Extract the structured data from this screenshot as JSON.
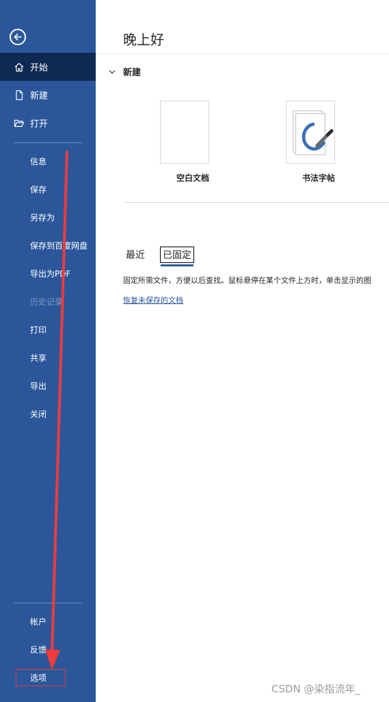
{
  "sidebar": {
    "top_items": [
      {
        "label": "开始",
        "icon": "home-icon"
      },
      {
        "label": "新建",
        "icon": "new-document-icon"
      },
      {
        "label": "打开",
        "icon": "open-folder-icon"
      }
    ],
    "sub_items": [
      {
        "label": "信息"
      },
      {
        "label": "保存"
      },
      {
        "label": "另存为"
      },
      {
        "label": "保存到百度网盘"
      },
      {
        "label": "导出为PDF"
      },
      {
        "label": "历史记录"
      },
      {
        "label": "打印"
      },
      {
        "label": "共享"
      },
      {
        "label": "导出"
      },
      {
        "label": "关闭"
      }
    ],
    "bottom_items": [
      {
        "label": "帐户"
      },
      {
        "label": "反馈"
      },
      {
        "label": "选项"
      }
    ]
  },
  "main": {
    "greeting": "晚上好",
    "new_section_title": "新建",
    "templates": [
      {
        "label": "空白文档"
      },
      {
        "label": "书法字帖"
      }
    ],
    "tabs": [
      {
        "label": "最近"
      },
      {
        "label": "已固定"
      }
    ],
    "pinned_description": "固定所需文件，方便以后查找。鼠标悬停在某个文件上方时，单击显示的图",
    "recover_link": "恢复未保存的文档"
  },
  "watermark": "CSDN @染指流年_",
  "colors": {
    "sidebar_bg": "#2b579a",
    "sidebar_active_bg": "#0f2a52",
    "annotation_red": "#e53935"
  }
}
